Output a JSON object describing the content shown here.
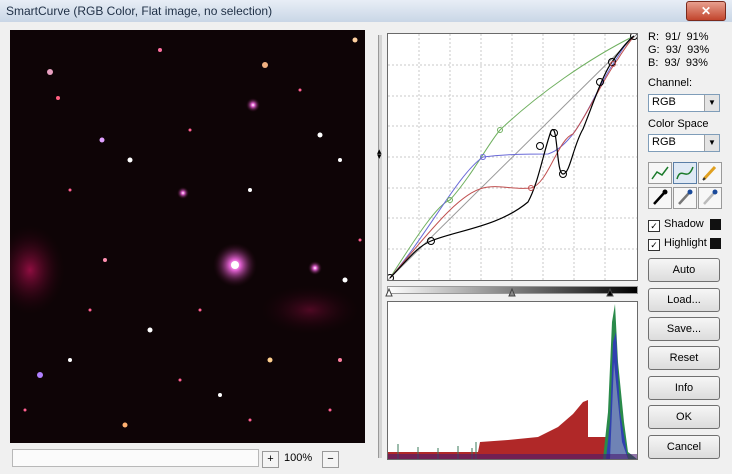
{
  "window": {
    "title": "SmartCurve (RGB Color, Flat image, no selection)",
    "close_symbol": "✕"
  },
  "readout": {
    "r": "R:  91/  91%",
    "g": "G:  93/  93%",
    "b": "B:  93/  93%"
  },
  "channel": {
    "label": "Channel:",
    "value": "RGB"
  },
  "colorspace": {
    "label": "Color Space",
    "value": "RGB"
  },
  "checks": {
    "shadow": "Shadow",
    "highlight": "Highlight"
  },
  "buttons": {
    "auto": "Auto",
    "load": "Load...",
    "save": "Save...",
    "reset": "Reset",
    "info": "Info",
    "ok": "OK",
    "cancel": "Cancel"
  },
  "zoom": {
    "value": "100%",
    "plus": "+",
    "minus": "−"
  },
  "colors": {
    "black_curve": "#000000",
    "red_curve": "#c05050",
    "green_curve": "#70b060",
    "blue_curve": "#6a6ad8"
  }
}
